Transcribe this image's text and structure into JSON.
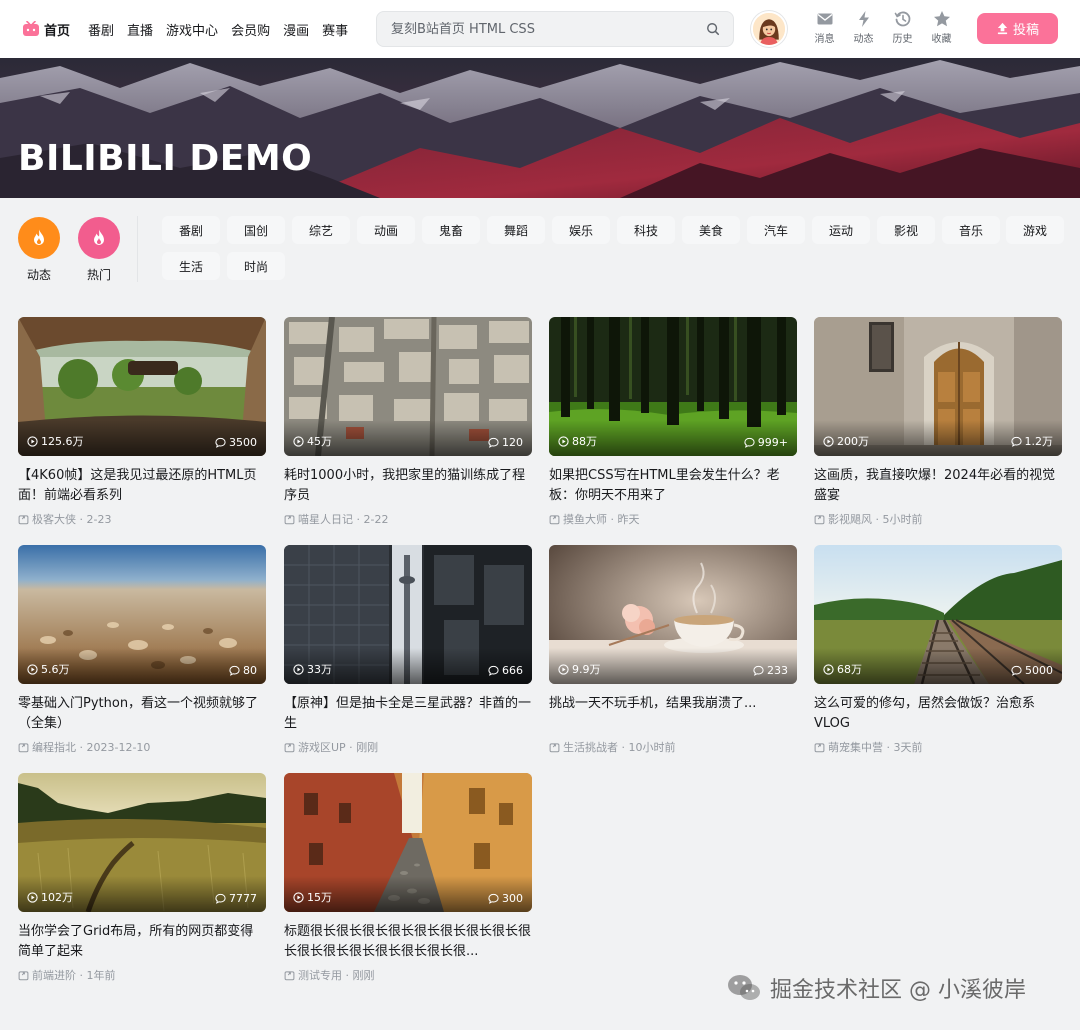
{
  "header": {
    "nav": [
      {
        "label": "首页",
        "icon": "tv-icon"
      },
      {
        "label": "番剧"
      },
      {
        "label": "直播"
      },
      {
        "label": "游戏中心"
      },
      {
        "label": "会员购"
      },
      {
        "label": "漫画"
      },
      {
        "label": "赛事"
      }
    ],
    "search_placeholder": "复刻B站首页 HTML CSS",
    "right_icons": [
      {
        "label": "消息",
        "icon": "mail-icon"
      },
      {
        "label": "动态",
        "icon": "lightning-icon"
      },
      {
        "label": "历史",
        "icon": "history-icon"
      },
      {
        "label": "收藏",
        "icon": "star-icon"
      }
    ],
    "upload_label": "投稿"
  },
  "banner": {
    "title": "BILIBILI DEMO"
  },
  "channels": {
    "big": [
      {
        "label": "动态",
        "color": "#ff8c1a",
        "icon": "flame-icon"
      },
      {
        "label": "热门",
        "color": "#f25d8e",
        "icon": "fire-icon"
      }
    ],
    "tags": [
      "番剧",
      "国创",
      "综艺",
      "动画",
      "鬼畜",
      "舞蹈",
      "娱乐",
      "科技",
      "美食",
      "汽车",
      "运动",
      "影视",
      "音乐",
      "游戏",
      "生活",
      "时尚"
    ]
  },
  "videos": [
    {
      "title": "【4K60帧】这是我见过最还原的HTML页面！前端必看系列",
      "plays": "125.6万",
      "danmu": "3500",
      "author": "极客大侠",
      "date": "2-23",
      "scene": "car"
    },
    {
      "title": "耗时1000小时，我把家里的猫训练成了程序员",
      "plays": "45万",
      "danmu": "120",
      "author": "喵星人日记",
      "date": "2-22",
      "scene": "city"
    },
    {
      "title": "如果把CSS写在HTML里会发生什么？老板：你明天不用来了",
      "plays": "88万",
      "danmu": "999+",
      "author": "摸鱼大师",
      "date": "昨天",
      "scene": "forest"
    },
    {
      "title": "这画质，我直接吹爆！2024年必看的视觉盛宴",
      "plays": "200万",
      "danmu": "1.2万",
      "author": "影视飓风",
      "date": "5小时前",
      "scene": "door"
    },
    {
      "title": "零基础入门Python，看这一个视频就够了（全集）",
      "plays": "5.6万",
      "danmu": "80",
      "author": "编程指北",
      "date": "2023-12-10",
      "scene": "pebbles"
    },
    {
      "title": "【原神】但是抽卡全是三星武器？非酋的一生",
      "plays": "33万",
      "danmu": "666",
      "author": "游戏区UP",
      "date": "刚刚",
      "scene": "tower"
    },
    {
      "title": "挑战一天不玩手机，结果我崩溃了...",
      "plays": "9.9万",
      "danmu": "233",
      "author": "生活挑战者",
      "date": "10小时前",
      "scene": "tea"
    },
    {
      "title": "这么可爱的修勾，居然会做饭？治愈系VLOG",
      "plays": "68万",
      "danmu": "5000",
      "author": "萌宠集中营",
      "date": "3天前",
      "scene": "rail"
    },
    {
      "title": "当你学会了Grid布局，所有的网页都变得简单了起来",
      "plays": "102万",
      "danmu": "7777",
      "author": "前端进阶",
      "date": "1年前",
      "scene": "field"
    },
    {
      "title": "标题很长很长很长很长很长很长很长很长很长很长很长很长很长很长很长很...",
      "plays": "15万",
      "danmu": "300",
      "author": "测试专用",
      "date": "刚刚",
      "scene": "alley"
    }
  ],
  "watermark": "掘金技术社区 @ 小溪彼岸",
  "colors": {
    "accent": "#fb7299",
    "orange": "#ff8c1a",
    "pink": "#f25d8e"
  }
}
